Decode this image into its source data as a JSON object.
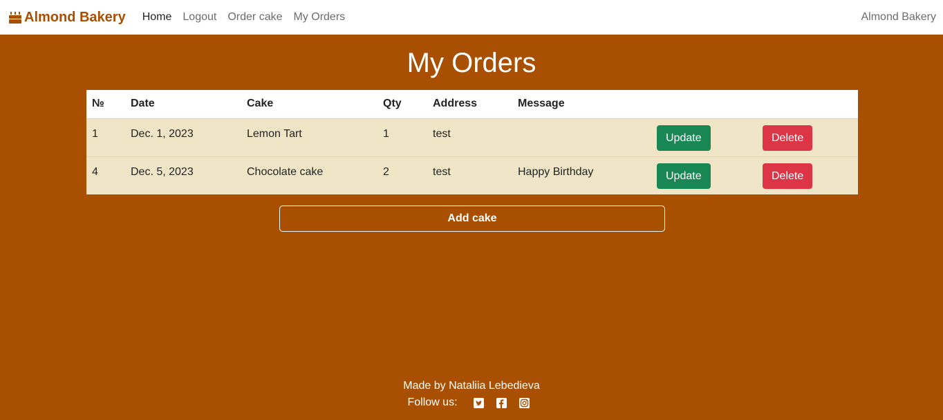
{
  "nav": {
    "brand": "Almond Bakery",
    "links": [
      "Home",
      "Logout",
      "Order cake",
      "My Orders"
    ],
    "right_text": "Almond Bakery"
  },
  "page_title": "My Orders",
  "table": {
    "headers": [
      "№",
      "Date",
      "Cake",
      "Qty",
      "Address",
      "Message"
    ],
    "rows": [
      {
        "num": "1",
        "date": "Dec. 1, 2023",
        "cake": "Lemon Tart",
        "qty": "1",
        "address": "test",
        "message": ""
      },
      {
        "num": "4",
        "date": "Dec. 5, 2023",
        "cake": "Chocolate cake",
        "qty": "2",
        "address": "test",
        "message": "Happy Birthday"
      }
    ],
    "update_label": "Update",
    "delete_label": "Delete"
  },
  "add_cake_label": "Add cake",
  "footer": {
    "made_by": "Made by Nataliia Lebedieva",
    "follow": "Follow us:",
    "icons": [
      "twitter-icon",
      "facebook-icon",
      "instagram-icon"
    ]
  },
  "colors": {
    "background": "#a84f02",
    "row": "#f0e6c7",
    "update": "#198754",
    "delete": "#dc3545"
  }
}
